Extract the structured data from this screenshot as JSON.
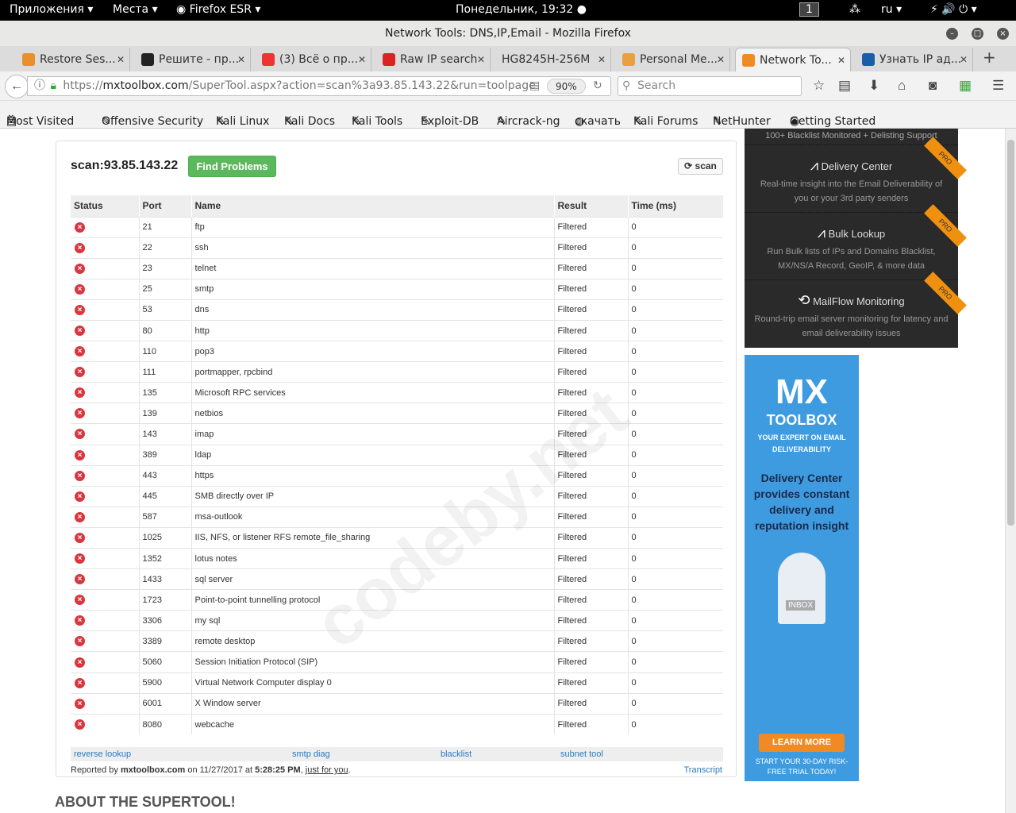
{
  "system": {
    "apps": "Приложения",
    "places": "Места",
    "browser": "Firefox ESR",
    "clock": "Понедельник, 19:32",
    "workspace": "1",
    "lang": "ru"
  },
  "window": {
    "title": "Network Tools: DNS,IP,Email - Mozilla Firefox"
  },
  "tabs": [
    {
      "label": "Restore Ses...",
      "color": "#e8902a"
    },
    {
      "label": "Решите - пр...",
      "color": "#222"
    },
    {
      "label": "(3) Всё о пр...",
      "color": "#e33"
    },
    {
      "label": "Raw IP search",
      "color": "#d22"
    },
    {
      "label": "HG8245H-256M",
      "color": ""
    },
    {
      "label": "Personal Me...",
      "color": "#e8a040"
    },
    {
      "label": "Network To...",
      "color": "#f08a24"
    },
    {
      "label": "Узнать IP ад...",
      "color": "#1a5ea8"
    }
  ],
  "nav": {
    "url_prefix": "https://",
    "url_domain": "mxtoolbox.com",
    "url_rest": "/SuperTool.aspx?action=scan%3a93.85.143.22&run=toolpage",
    "zoom": "90%",
    "search_placeholder": "Search"
  },
  "bookmarks": [
    "Most Visited",
    "Offensive Security",
    "Kali Linux",
    "Kali Docs",
    "Kali Tools",
    "Exploit-DB",
    "Aircrack-ng",
    "скачать",
    "Kali Forums",
    "NetHunter",
    "Getting Started"
  ],
  "scan": {
    "title": "scan:93.85.143.22",
    "find_problems": "Find Problems",
    "scan_button": "scan",
    "columns": [
      "Status",
      "Port",
      "Name",
      "Result",
      "Time (ms)"
    ],
    "rows": [
      [
        "21",
        "ftp",
        "Filtered",
        "0"
      ],
      [
        "22",
        "ssh",
        "Filtered",
        "0"
      ],
      [
        "23",
        "telnet",
        "Filtered",
        "0"
      ],
      [
        "25",
        "smtp",
        "Filtered",
        "0"
      ],
      [
        "53",
        "dns",
        "Filtered",
        "0"
      ],
      [
        "80",
        "http",
        "Filtered",
        "0"
      ],
      [
        "110",
        "pop3",
        "Filtered",
        "0"
      ],
      [
        "111",
        "portmapper, rpcbind",
        "Filtered",
        "0"
      ],
      [
        "135",
        "Microsoft RPC services",
        "Filtered",
        "0"
      ],
      [
        "139",
        "netbios",
        "Filtered",
        "0"
      ],
      [
        "143",
        "imap",
        "Filtered",
        "0"
      ],
      [
        "389",
        "ldap",
        "Filtered",
        "0"
      ],
      [
        "443",
        "https",
        "Filtered",
        "0"
      ],
      [
        "445",
        "SMB directly over IP",
        "Filtered",
        "0"
      ],
      [
        "587",
        "msa-outlook",
        "Filtered",
        "0"
      ],
      [
        "1025",
        "IIS, NFS, or listener RFS remote_file_sharing",
        "Filtered",
        "0"
      ],
      [
        "1352",
        "lotus notes",
        "Filtered",
        "0"
      ],
      [
        "1433",
        "sql server",
        "Filtered",
        "0"
      ],
      [
        "1723",
        "Point-to-point tunnelling protocol",
        "Filtered",
        "0"
      ],
      [
        "3306",
        "my sql",
        "Filtered",
        "0"
      ],
      [
        "3389",
        "remote desktop",
        "Filtered",
        "0"
      ],
      [
        "5060",
        "Session Initiation Protocol (SIP)",
        "Filtered",
        "0"
      ],
      [
        "5900",
        "Virtual Network Computer display 0",
        "Filtered",
        "0"
      ],
      [
        "6001",
        "X Window server",
        "Filtered",
        "0"
      ],
      [
        "8080",
        "webcache",
        "Filtered",
        "0"
      ]
    ],
    "links": [
      "reverse lookup",
      "smtp diag",
      "blacklist",
      "subnet tool"
    ],
    "reported_prefix": "Reported by ",
    "reported_site": "mxtoolbox.com",
    "reported_on": " on 11/27/2017 at ",
    "reported_time": "5:28:25 PM",
    "reported_comma": ", ",
    "reported_link": "just for you",
    "reported_end": ".",
    "transcript": "Transcript"
  },
  "about": "ABOUT THE SUPERTOOL!",
  "promo": {
    "top": "100+ Blacklist Monitored + Delisting Support",
    "badge": "PRO",
    "items": [
      {
        "title": "Delivery Center",
        "desc": "Real-time insight into the Email Deliverability of you or your 3rd party senders"
      },
      {
        "title": "Bulk Lookup",
        "desc": "Run Bulk lists of IPs and Domains Blacklist, MX/NS/A Record, GeoIP, & more data"
      },
      {
        "title": "MailFlow Monitoring",
        "desc": "Round-trip email server monitoring for latency and email deliverability issues"
      }
    ]
  },
  "ad": {
    "logo": "MX",
    "brand": "TOOLBOX",
    "tagline": "YOUR EXPERT ON EMAIL DELIVERABILITY",
    "headline": "Delivery Center provides constant delivery and reputation insight",
    "mailbox": "INBOX",
    "cta": "LEARN MORE",
    "trial": "START YOUR 30-DAY RISK-FREE TRIAL TODAY!"
  },
  "watermark": "codeby.net"
}
